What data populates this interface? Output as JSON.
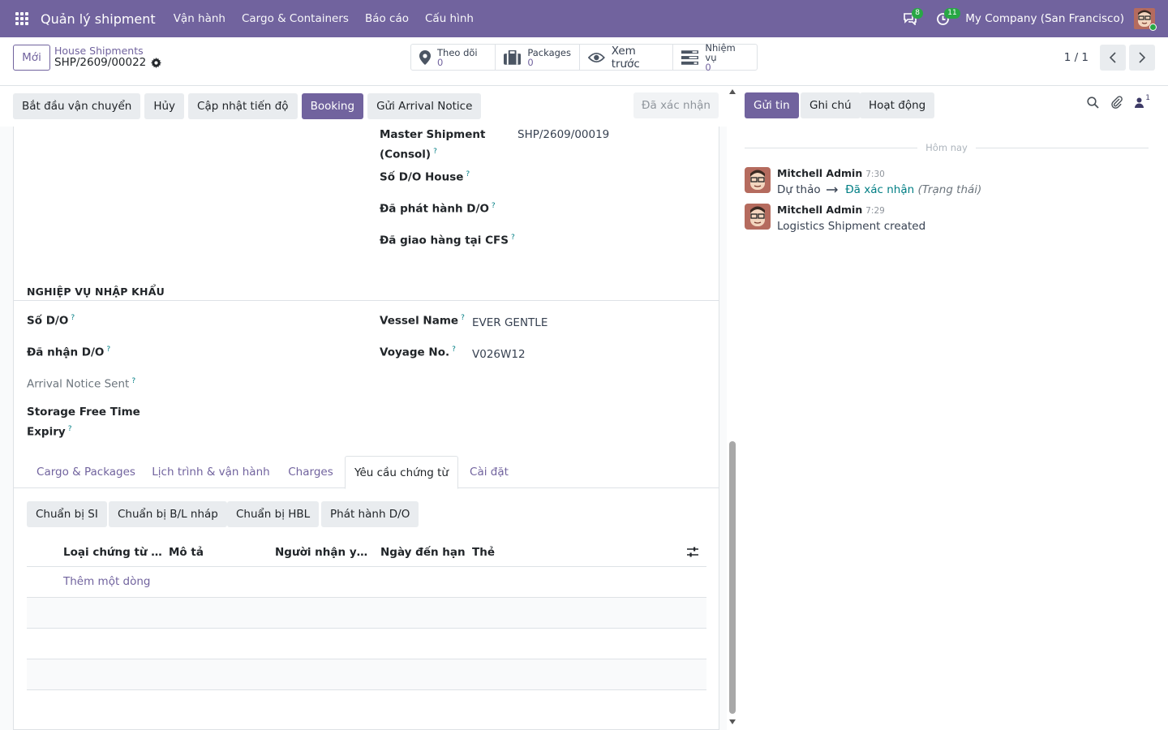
{
  "navbar": {
    "app_name": "Quản lý shipment",
    "menu": [
      "Vận hành",
      "Cargo & Containers",
      "Báo cáo",
      "Cấu hình"
    ],
    "messages_count": "8",
    "activities_count": "11",
    "company": "My Company (San Francisco)"
  },
  "control": {
    "new_label": "Mới",
    "breadcrumb_parent": "House Shipments",
    "breadcrumb_current": "SHP/2609/00022",
    "smart_buttons": [
      {
        "label": "Theo dõi",
        "value": "0",
        "icon": "map-marker-icon"
      },
      {
        "label": "Packages",
        "value": "0",
        "icon": "suitcase-icon"
      },
      {
        "label": "Xem trước",
        "icon": "eye-icon"
      },
      {
        "label": "Nhiệm vụ",
        "value": "0",
        "icon": "tasks-icon"
      }
    ],
    "pager": "1 / 1"
  },
  "statusbar": {
    "buttons": [
      "Bắt đầu vận chuyển",
      "Hủy",
      "Cập nhật tiến độ",
      "Booking",
      "Gửi Arrival Notice"
    ],
    "status": "Đã xác nhận"
  },
  "form": {
    "top_fields": [
      {
        "label_line1": "Master Shipment",
        "label_line2": "(Consol)",
        "value": "SHP/2609/00019"
      },
      {
        "label": "Số D/O House",
        "value": ""
      },
      {
        "label": "Đã phát hành D/O",
        "value": ""
      },
      {
        "label": "Đã giao hàng tại CFS",
        "value": ""
      }
    ],
    "import_section_title": "NGHIỆP VỤ NHẬP KHẨU",
    "left_fields": [
      {
        "label": "Số D/O"
      },
      {
        "label": "Đã nhận D/O"
      },
      {
        "label": "Arrival Notice Sent"
      },
      {
        "label_line1": "Storage Free Time",
        "label_line2": "Expiry"
      }
    ],
    "right_fields": [
      {
        "label": "Vessel Name",
        "value": "EVER GENTLE"
      },
      {
        "label": "Voyage No.",
        "value": "V026W12"
      }
    ],
    "tabs": [
      "Cargo & Packages",
      "Lịch trình & vận hành",
      "Charges",
      "Yêu cầu chứng từ",
      "Cài đặt"
    ],
    "active_tab": "Yêu cầu chứng từ",
    "tab_buttons": [
      "Chuẩn bị SI",
      "Chuẩn bị B/L nháp",
      "Chuẩn bị HBL",
      "Phát hành D/O"
    ],
    "table": {
      "columns": [
        "Loại chứng từ vậ...",
        "Mô tả",
        "Người nhận yêu ...",
        "Ngày đến hạn",
        "Thẻ"
      ],
      "add_line": "Thêm một dòng"
    }
  },
  "chatter": {
    "buttons": [
      "Gửi tin",
      "Ghi chú",
      "Hoạt động"
    ],
    "followers_count": "1",
    "date_separator": "Hôm nay",
    "messages": [
      {
        "author": "Mitchell Admin",
        "time": "7:30",
        "old_value": "Dự thảo",
        "new_value": "Đã xác nhận",
        "field": "(Trạng thái)"
      },
      {
        "author": "Mitchell Admin",
        "time": "7:29",
        "body": "Logistics Shipment created"
      }
    ]
  },
  "colors": {
    "brand": "#71639e",
    "link": "#017e84",
    "badge": "#28a745"
  }
}
